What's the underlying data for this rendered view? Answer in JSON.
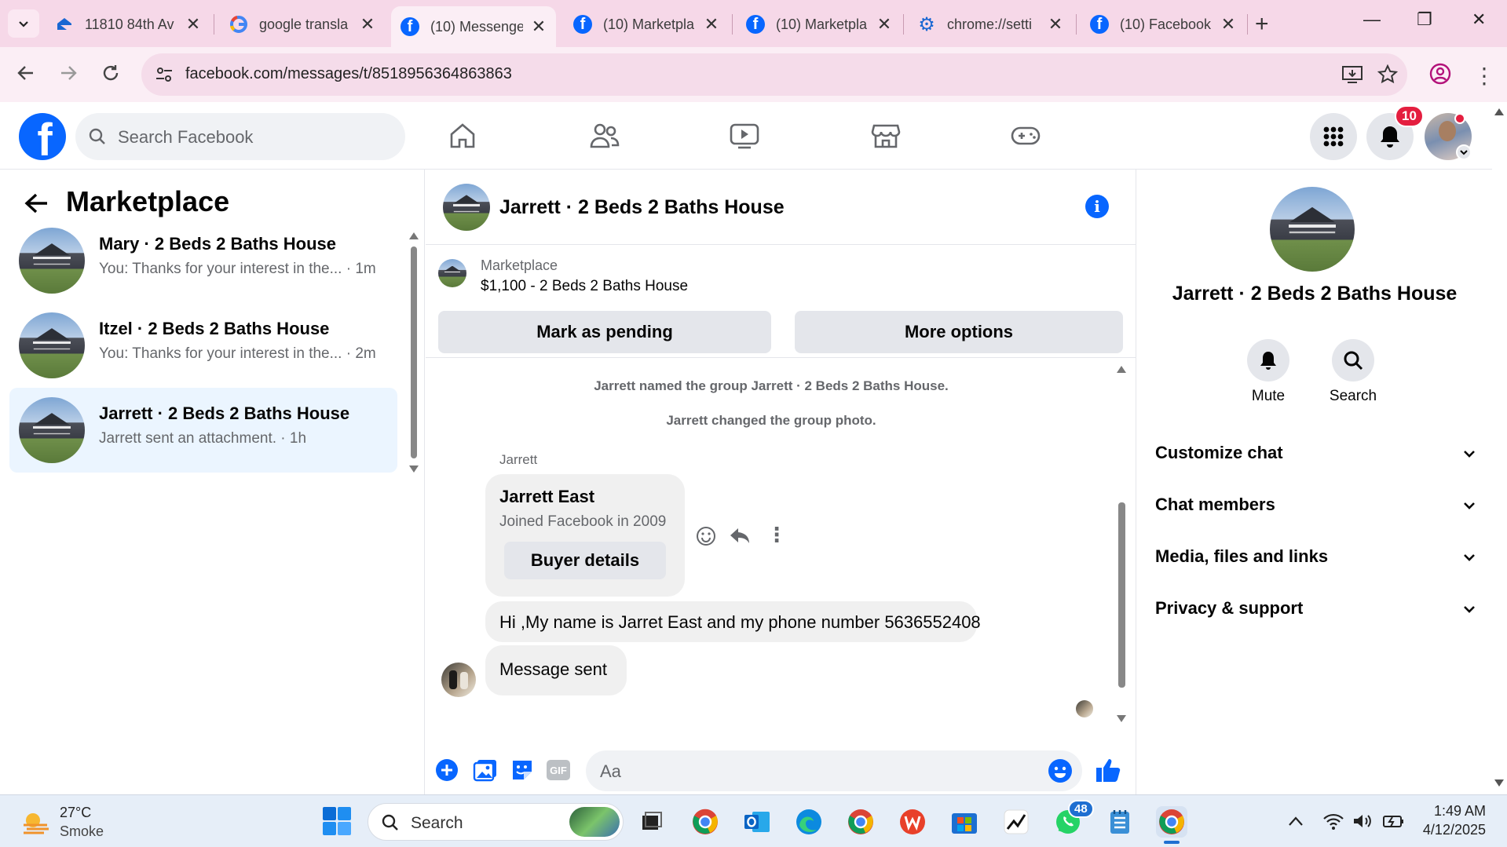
{
  "browser": {
    "tabs": [
      {
        "title": "11810 84th Av",
        "icon": "zillow-icon"
      },
      {
        "title": "google transla",
        "icon": "google-icon"
      },
      {
        "title": "(10) Messenge",
        "icon": "facebook-icon",
        "active": true
      },
      {
        "title": "(10) Marketpla",
        "icon": "facebook-icon"
      },
      {
        "title": "(10) Marketpla",
        "icon": "facebook-icon"
      },
      {
        "title": "chrome://setti",
        "icon": "settings-gear-icon"
      },
      {
        "title": "(10) Facebook",
        "icon": "facebook-icon"
      }
    ],
    "url": "facebook.com/messages/t/8518956364863863"
  },
  "facebook": {
    "search_placeholder": "Search Facebook",
    "notifications_count": "10"
  },
  "left": {
    "title": "Marketplace",
    "conversations": [
      {
        "name": "Mary · 2 Beds 2 Baths House",
        "preview": "You: Thanks for your interest in the... · 1m"
      },
      {
        "name": "Itzel · 2 Beds 2 Baths House",
        "preview": "You: Thanks for your interest in the... · 2m"
      },
      {
        "name": "Jarrett · 2 Beds 2 Baths House",
        "preview": "Jarrett sent an attachment. · 1h",
        "selected": true
      }
    ]
  },
  "chat": {
    "title": "Jarrett · 2 Beds 2 Baths House",
    "listing_label": "Marketplace",
    "listing_price": "$1,100 - 2 Beds 2 Baths House",
    "mark_pending": "Mark as pending",
    "more_options": "More options",
    "system_messages": [
      "Jarrett named the group Jarrett · 2 Beds 2 Baths House.",
      "Jarrett changed the group photo."
    ],
    "sender": "Jarrett",
    "card_name": "Jarrett East",
    "card_sub": "Joined Facebook in 2009",
    "card_button": "Buyer details",
    "message1": "Hi ,My name is Jarret East and my phone number 5636552408",
    "message2": "Message sent",
    "compose_placeholder": "Aa"
  },
  "right": {
    "name": "Jarrett · 2 Beds 2 Baths House",
    "mute": "Mute",
    "search": "Search",
    "sections": [
      "Customize chat",
      "Chat members",
      "Media, files and links",
      "Privacy & support"
    ]
  },
  "taskbar": {
    "temp": "27°C",
    "weather": "Smoke",
    "search": "Search",
    "whatsapp_badge": "48",
    "time": "1:49 AM",
    "date": "4/12/2025"
  },
  "colors": {
    "fb_blue": "#0866ff",
    "tab_strip": "#f6d8e8",
    "selected_conv": "#ebf5ff"
  }
}
